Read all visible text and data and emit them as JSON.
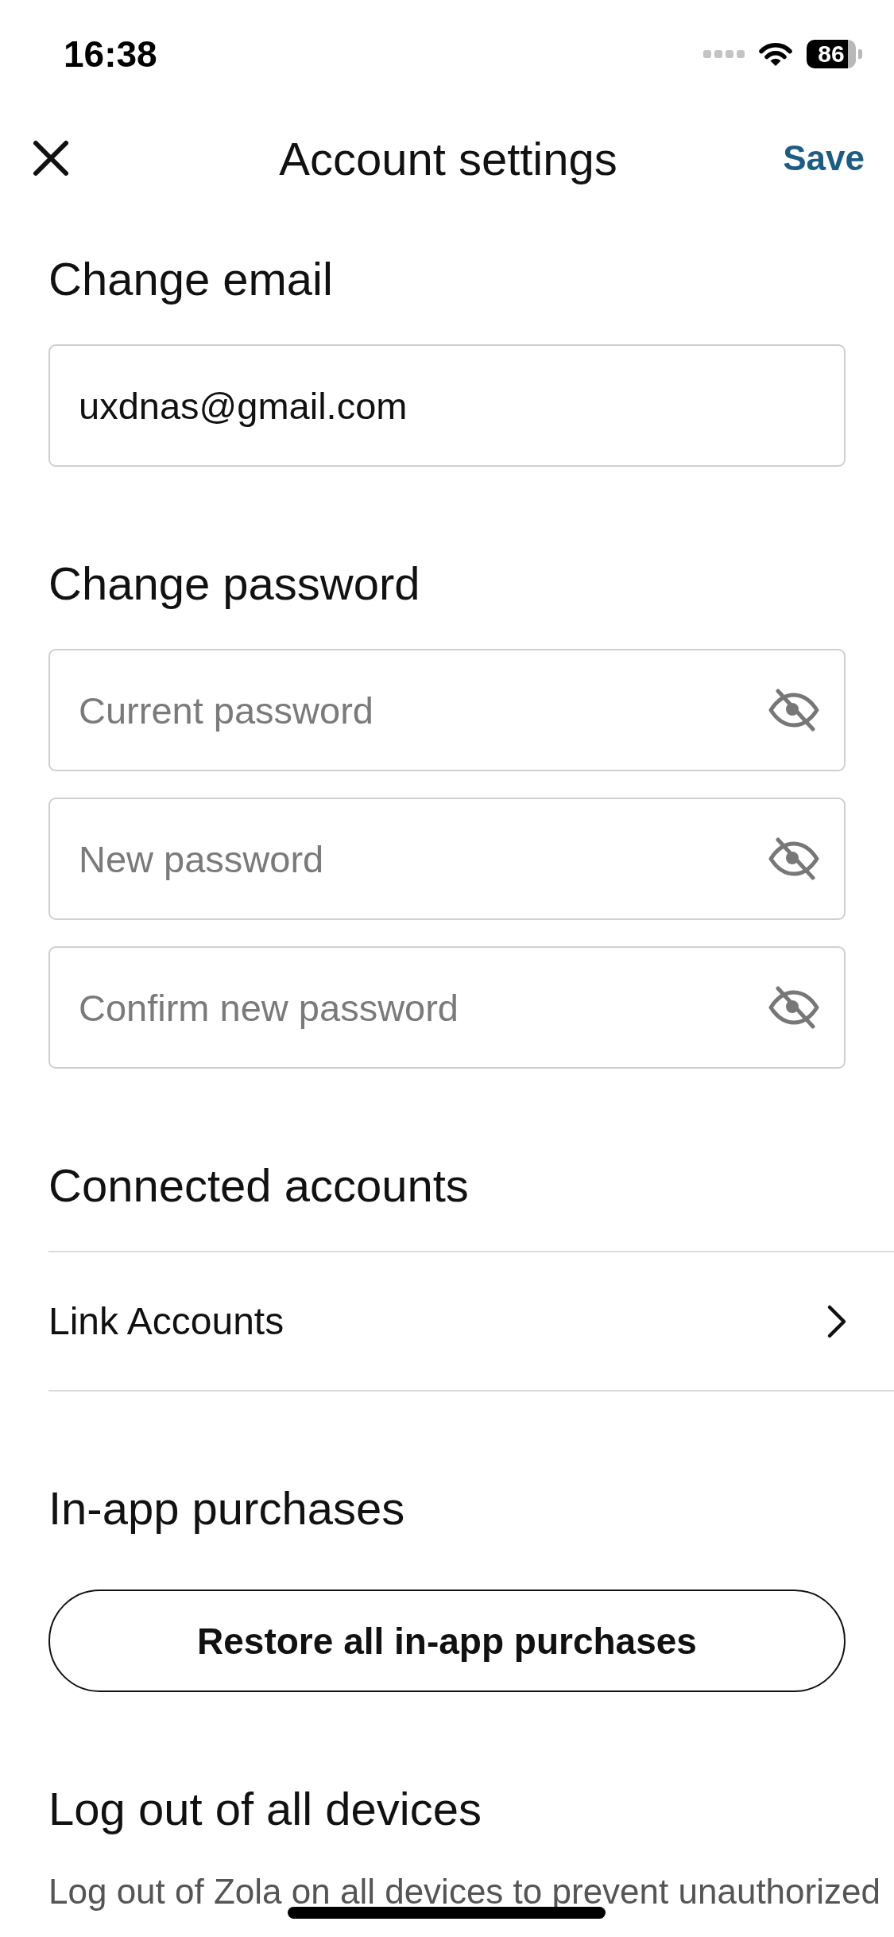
{
  "status_bar": {
    "time": "16:38",
    "battery": "86"
  },
  "header": {
    "title": "Account settings",
    "action": "Save"
  },
  "sections": [
    {
      "kind": "fields",
      "heading": "Change email",
      "fields": [
        {
          "value": "uxdnas@gmail.com",
          "secure": false
        }
      ]
    },
    {
      "kind": "fields",
      "heading": "Change password",
      "fields": [
        {
          "placeholder": "Current password",
          "secure": true
        },
        {
          "placeholder": "New password",
          "secure": true
        },
        {
          "placeholder": "Confirm new password",
          "secure": true
        }
      ]
    },
    {
      "kind": "links",
      "heading": "Connected accounts",
      "items": [
        {
          "label": "Link Accounts"
        }
      ]
    },
    {
      "kind": "button",
      "heading": "In-app purchases",
      "button": "Restore all in-app purchases"
    },
    {
      "kind": "text",
      "heading": "Log out of all devices",
      "text": "Log out of Zola on all devices to prevent unauthorized"
    }
  ]
}
